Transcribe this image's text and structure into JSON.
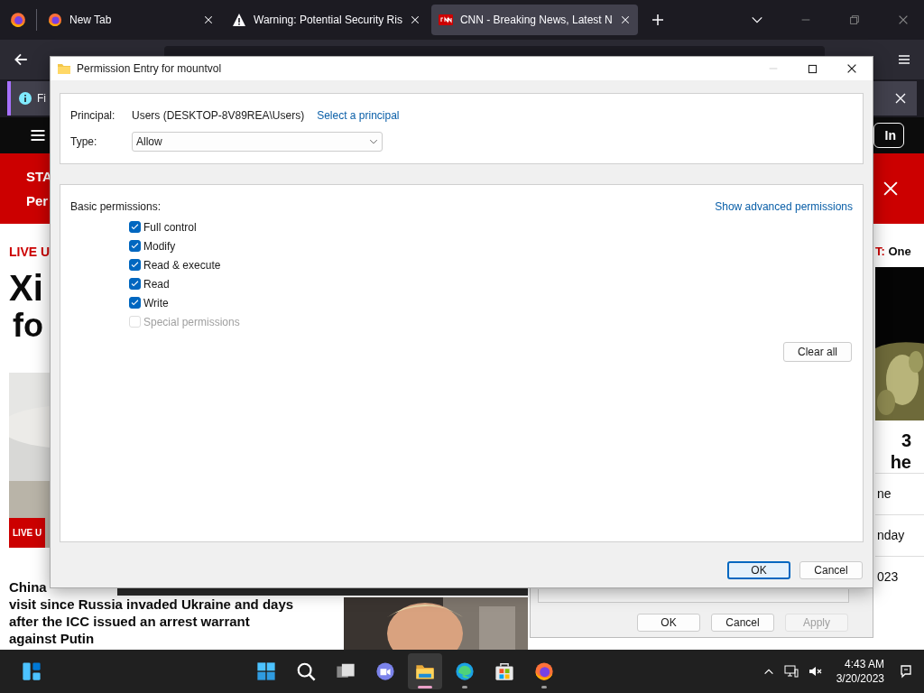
{
  "browser": {
    "tabs": [
      {
        "title": "New Tab",
        "selected": false
      },
      {
        "title": "Warning: Potential Security Ris",
        "selected": false
      },
      {
        "title": "CNN - Breaking News, Latest N",
        "selected": true
      }
    ],
    "notification": {
      "text": "Fi"
    }
  },
  "page": {
    "nav": {
      "sign_in": "In"
    },
    "banner": {
      "line_1": "STA",
      "line_2": "Per"
    },
    "lead": {
      "label": "LIVE U",
      "headline_1": "Xi",
      "headline_2": "fo",
      "badge": "LIVE U",
      "story_lines": [
        "China",
        "visit since Russia invaded Ukraine and days",
        "after the ICC issued an arrest warrant",
        "against Putin"
      ]
    },
    "side": {
      "label": "T:",
      "label_rest": "One",
      "headline_lines": [
        "3",
        "he"
      ],
      "items": [
        "ne",
        "nday",
        "023"
      ]
    }
  },
  "back_dialog": {
    "buttons": [
      {
        "label": "OK",
        "disabled": false
      },
      {
        "label": "Cancel",
        "disabled": false
      },
      {
        "label": "Apply",
        "disabled": true
      }
    ]
  },
  "dialog": {
    "title": "Permission Entry for mountvol",
    "principal_label": "Principal:",
    "principal": "Users (DESKTOP-8V89REA\\Users)",
    "select_principal": "Select a principal",
    "type_label": "Type:",
    "type": "Allow",
    "permissions_label": "Basic permissions:",
    "advanced_link": "Show advanced permissions",
    "permissions": [
      {
        "label": "Full control",
        "checked": true,
        "disabled": false
      },
      {
        "label": "Modify",
        "checked": true,
        "disabled": false
      },
      {
        "label": "Read & execute",
        "checked": true,
        "disabled": false
      },
      {
        "label": "Read",
        "checked": true,
        "disabled": false
      },
      {
        "label": "Write",
        "checked": true,
        "disabled": false
      },
      {
        "label": "Special permissions",
        "checked": false,
        "disabled": true
      }
    ],
    "clear_all": "Clear all",
    "buttons": [
      {
        "label": "OK",
        "focused": true
      },
      {
        "label": "Cancel",
        "focused": false
      }
    ]
  },
  "taskbar": {
    "apps": [
      {
        "kind": "start",
        "running": false,
        "active": false
      },
      {
        "kind": "search",
        "running": false,
        "active": false
      },
      {
        "kind": "taskview",
        "running": false,
        "active": false
      },
      {
        "kind": "teams",
        "running": false,
        "active": false
      },
      {
        "kind": "explorer",
        "running": true,
        "active": true
      },
      {
        "kind": "edge",
        "running": true,
        "active": false
      },
      {
        "kind": "store",
        "running": false,
        "active": false
      },
      {
        "kind": "firefox",
        "running": true,
        "active": false
      }
    ],
    "time": "4:43 AM",
    "date": "3/20/2023"
  }
}
